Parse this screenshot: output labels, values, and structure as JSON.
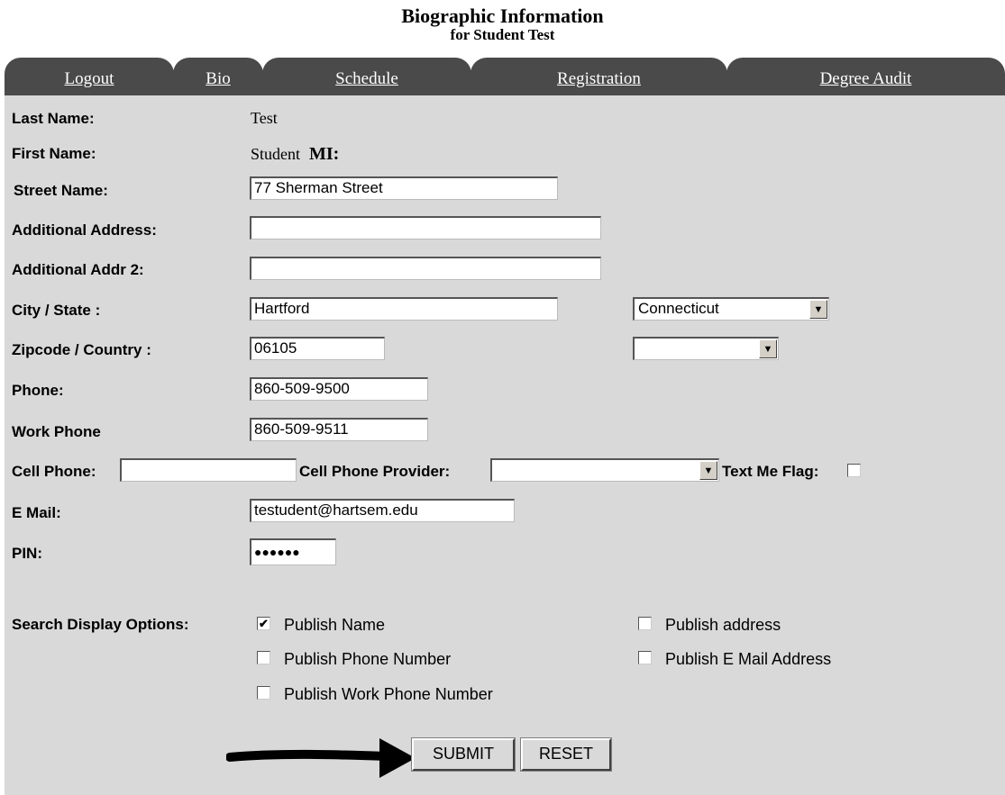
{
  "header": {
    "title": "Biographic Information",
    "subtitle": "for Student Test"
  },
  "nav": {
    "tabs": [
      "Logout",
      "Bio",
      "Schedule",
      "Registration",
      "Degree Audit"
    ]
  },
  "form": {
    "last_name_label": "Last Name:",
    "last_name_value": "Test",
    "first_name_label": "First Name:",
    "first_name_value": "Student",
    "mi_label": "MI:",
    "street_label": "Street Name:",
    "street_value": "77 Sherman Street",
    "addr1_label": "Additional Address:",
    "addr1_value": "",
    "addr2_label": "Additional Addr 2:",
    "addr2_value": "",
    "city_state_label": "City / State :",
    "city_value": "Hartford",
    "state_value": "Connecticut",
    "zip_country_label": "Zipcode / Country :",
    "zip_value": "06105",
    "country_value": "",
    "phone_label": "Phone:",
    "phone_value": "860-509-9500",
    "work_phone_label": "Work Phone",
    "work_phone_value": "860-509-9511",
    "cell_phone_label": "Cell Phone:",
    "cell_phone_value": "",
    "cell_provider_label": "Cell Phone Provider:",
    "cell_provider_value": "",
    "text_me_label": "Text Me Flag:",
    "text_me_checked": false,
    "email_label": "E Mail:",
    "email_value": "testudent@hartsem.edu",
    "pin_label": "PIN:",
    "pin_value": "●●●●●●",
    "search_options_label": "Search Display Options:",
    "options": [
      {
        "label": "Publish Name",
        "checked": true
      },
      {
        "label": "Publish address",
        "checked": false
      },
      {
        "label": "Publish Phone Number",
        "checked": false
      },
      {
        "label": "Publish E Mail Address",
        "checked": false
      },
      {
        "label": "Publish Work Phone Number",
        "checked": false
      }
    ],
    "submit_label": "SUBMIT",
    "reset_label": "RESET"
  },
  "icons": {
    "arrow": "right-arrow-icon",
    "dropdown": "chevron-down-icon"
  }
}
